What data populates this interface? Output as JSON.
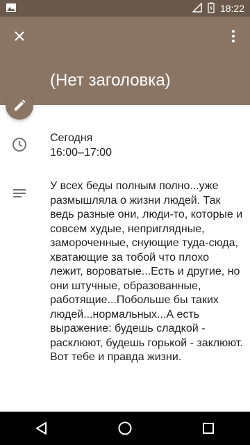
{
  "status_bar": {
    "time": "18:22"
  },
  "header": {
    "title": "(Нет заголовка)"
  },
  "event": {
    "date": "Сегодня",
    "time_range": "16:00–17:00",
    "description": "У всех беды полным полно...уже размышляла о жизни людей. Так ведь разные они, люди-то, которые и совсем худые, неприглядные, замороченные, снующие туда-сюда, хватающие за тобой что плохо лежит, вороватые...Есть и другие, но они штучные, образованные, работящие...Побольше бы таких людей...нормальных...А есть выражение: будешь сладкой - расклюют, будешь горькой - заклюют. Вот тебе и правда жизни."
  },
  "icons": {
    "close": "close-icon",
    "more": "more-vert-icon",
    "edit": "edit-icon",
    "clock": "clock-icon",
    "notes": "notes-icon",
    "nav_back": "back-triangle-icon",
    "nav_home": "home-circle-icon",
    "nav_recents": "recents-square-icon"
  },
  "colors": {
    "header": "#8a7564",
    "status_bar": "#6b5a4b"
  }
}
